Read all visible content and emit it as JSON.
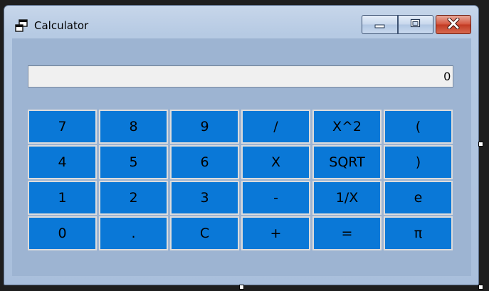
{
  "window": {
    "title": "Calculator",
    "icon": "app-window-icon",
    "caption_buttons": [
      {
        "name": "minimize",
        "icon": "minimize-icon"
      },
      {
        "name": "maximize",
        "icon": "maximize-icon"
      },
      {
        "name": "close",
        "icon": "close-icon"
      }
    ]
  },
  "display": {
    "value": "0"
  },
  "keypad": {
    "rows": [
      [
        "7",
        "8",
        "9",
        "/",
        "X^2",
        "("
      ],
      [
        "4",
        "5",
        "6",
        "X",
        "SQRT",
        ")"
      ],
      [
        "1",
        "2",
        "3",
        "-",
        "1/X",
        "e"
      ],
      [
        "0",
        ".",
        "C",
        "+",
        "=",
        "π"
      ]
    ]
  },
  "colors": {
    "key_background": "#0a78d7",
    "key_border": "#dcdcdc",
    "client_background": "#9db4d2",
    "display_background": "#f0f0f0",
    "close_button": "#c23a23"
  }
}
